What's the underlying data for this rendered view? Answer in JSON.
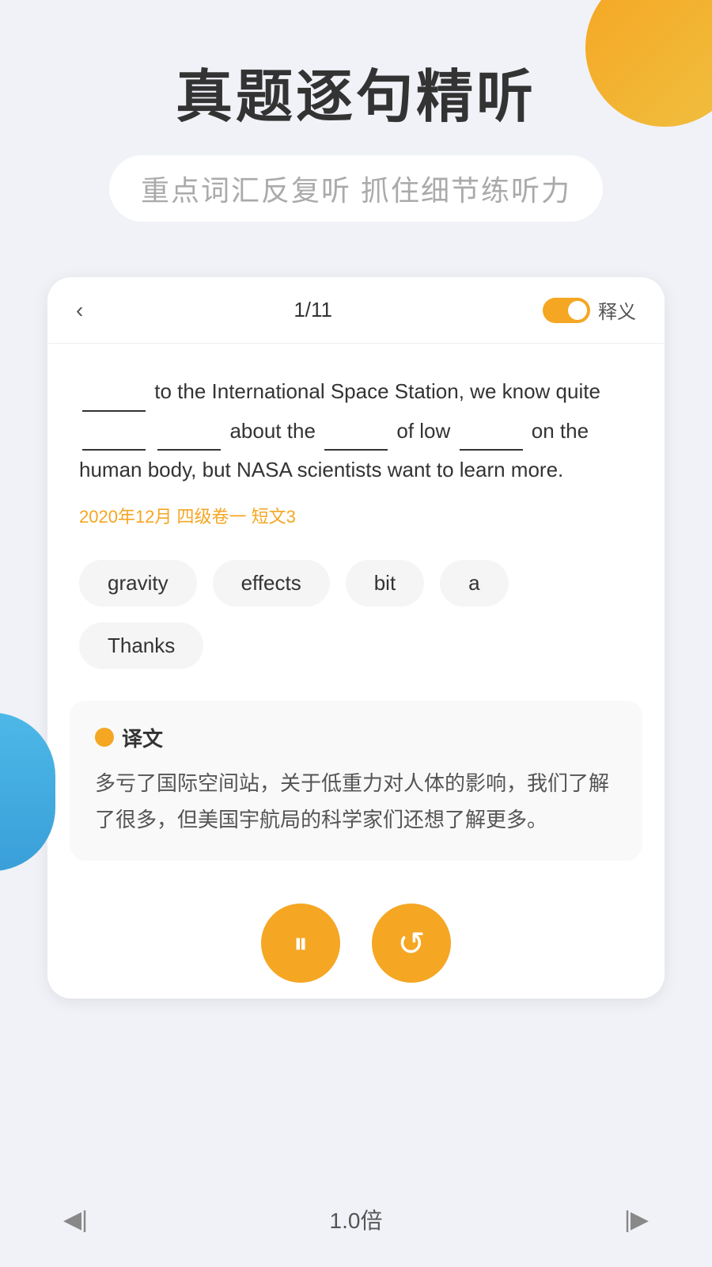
{
  "background": {
    "color": "#f0f2f7"
  },
  "header": {
    "main_title": "真题逐句精听",
    "subtitle": "重点词汇反复听  抓住细节练听力"
  },
  "card": {
    "nav": {
      "back_label": "‹",
      "progress": "1/11",
      "toggle_label": "释义"
    },
    "sentence": {
      "text_parts": [
        "________ to the International Space Station, we know quite ________ ________ about the ________ of low ________ on the human body, but NASA scientists want to learn more."
      ],
      "source": "2020年12月 四级卷一 短文3"
    },
    "word_chips": [
      {
        "id": 1,
        "word": "gravity"
      },
      {
        "id": 2,
        "word": "effects"
      },
      {
        "id": 3,
        "word": "bit"
      },
      {
        "id": 4,
        "word": "a"
      },
      {
        "id": 5,
        "word": "Thanks"
      }
    ],
    "translation": {
      "title": "译文",
      "text": "多亏了国际空间站，关于低重力对人体的影响，我们了解了很多，但美国宇航局的科学家们还想了解更多。"
    },
    "controls": {
      "pause_label": "⏸",
      "replay_label": "↺"
    }
  },
  "bottom_bar": {
    "prev_label": "◀|",
    "speed": "1.0倍",
    "next_label": "|▶"
  }
}
